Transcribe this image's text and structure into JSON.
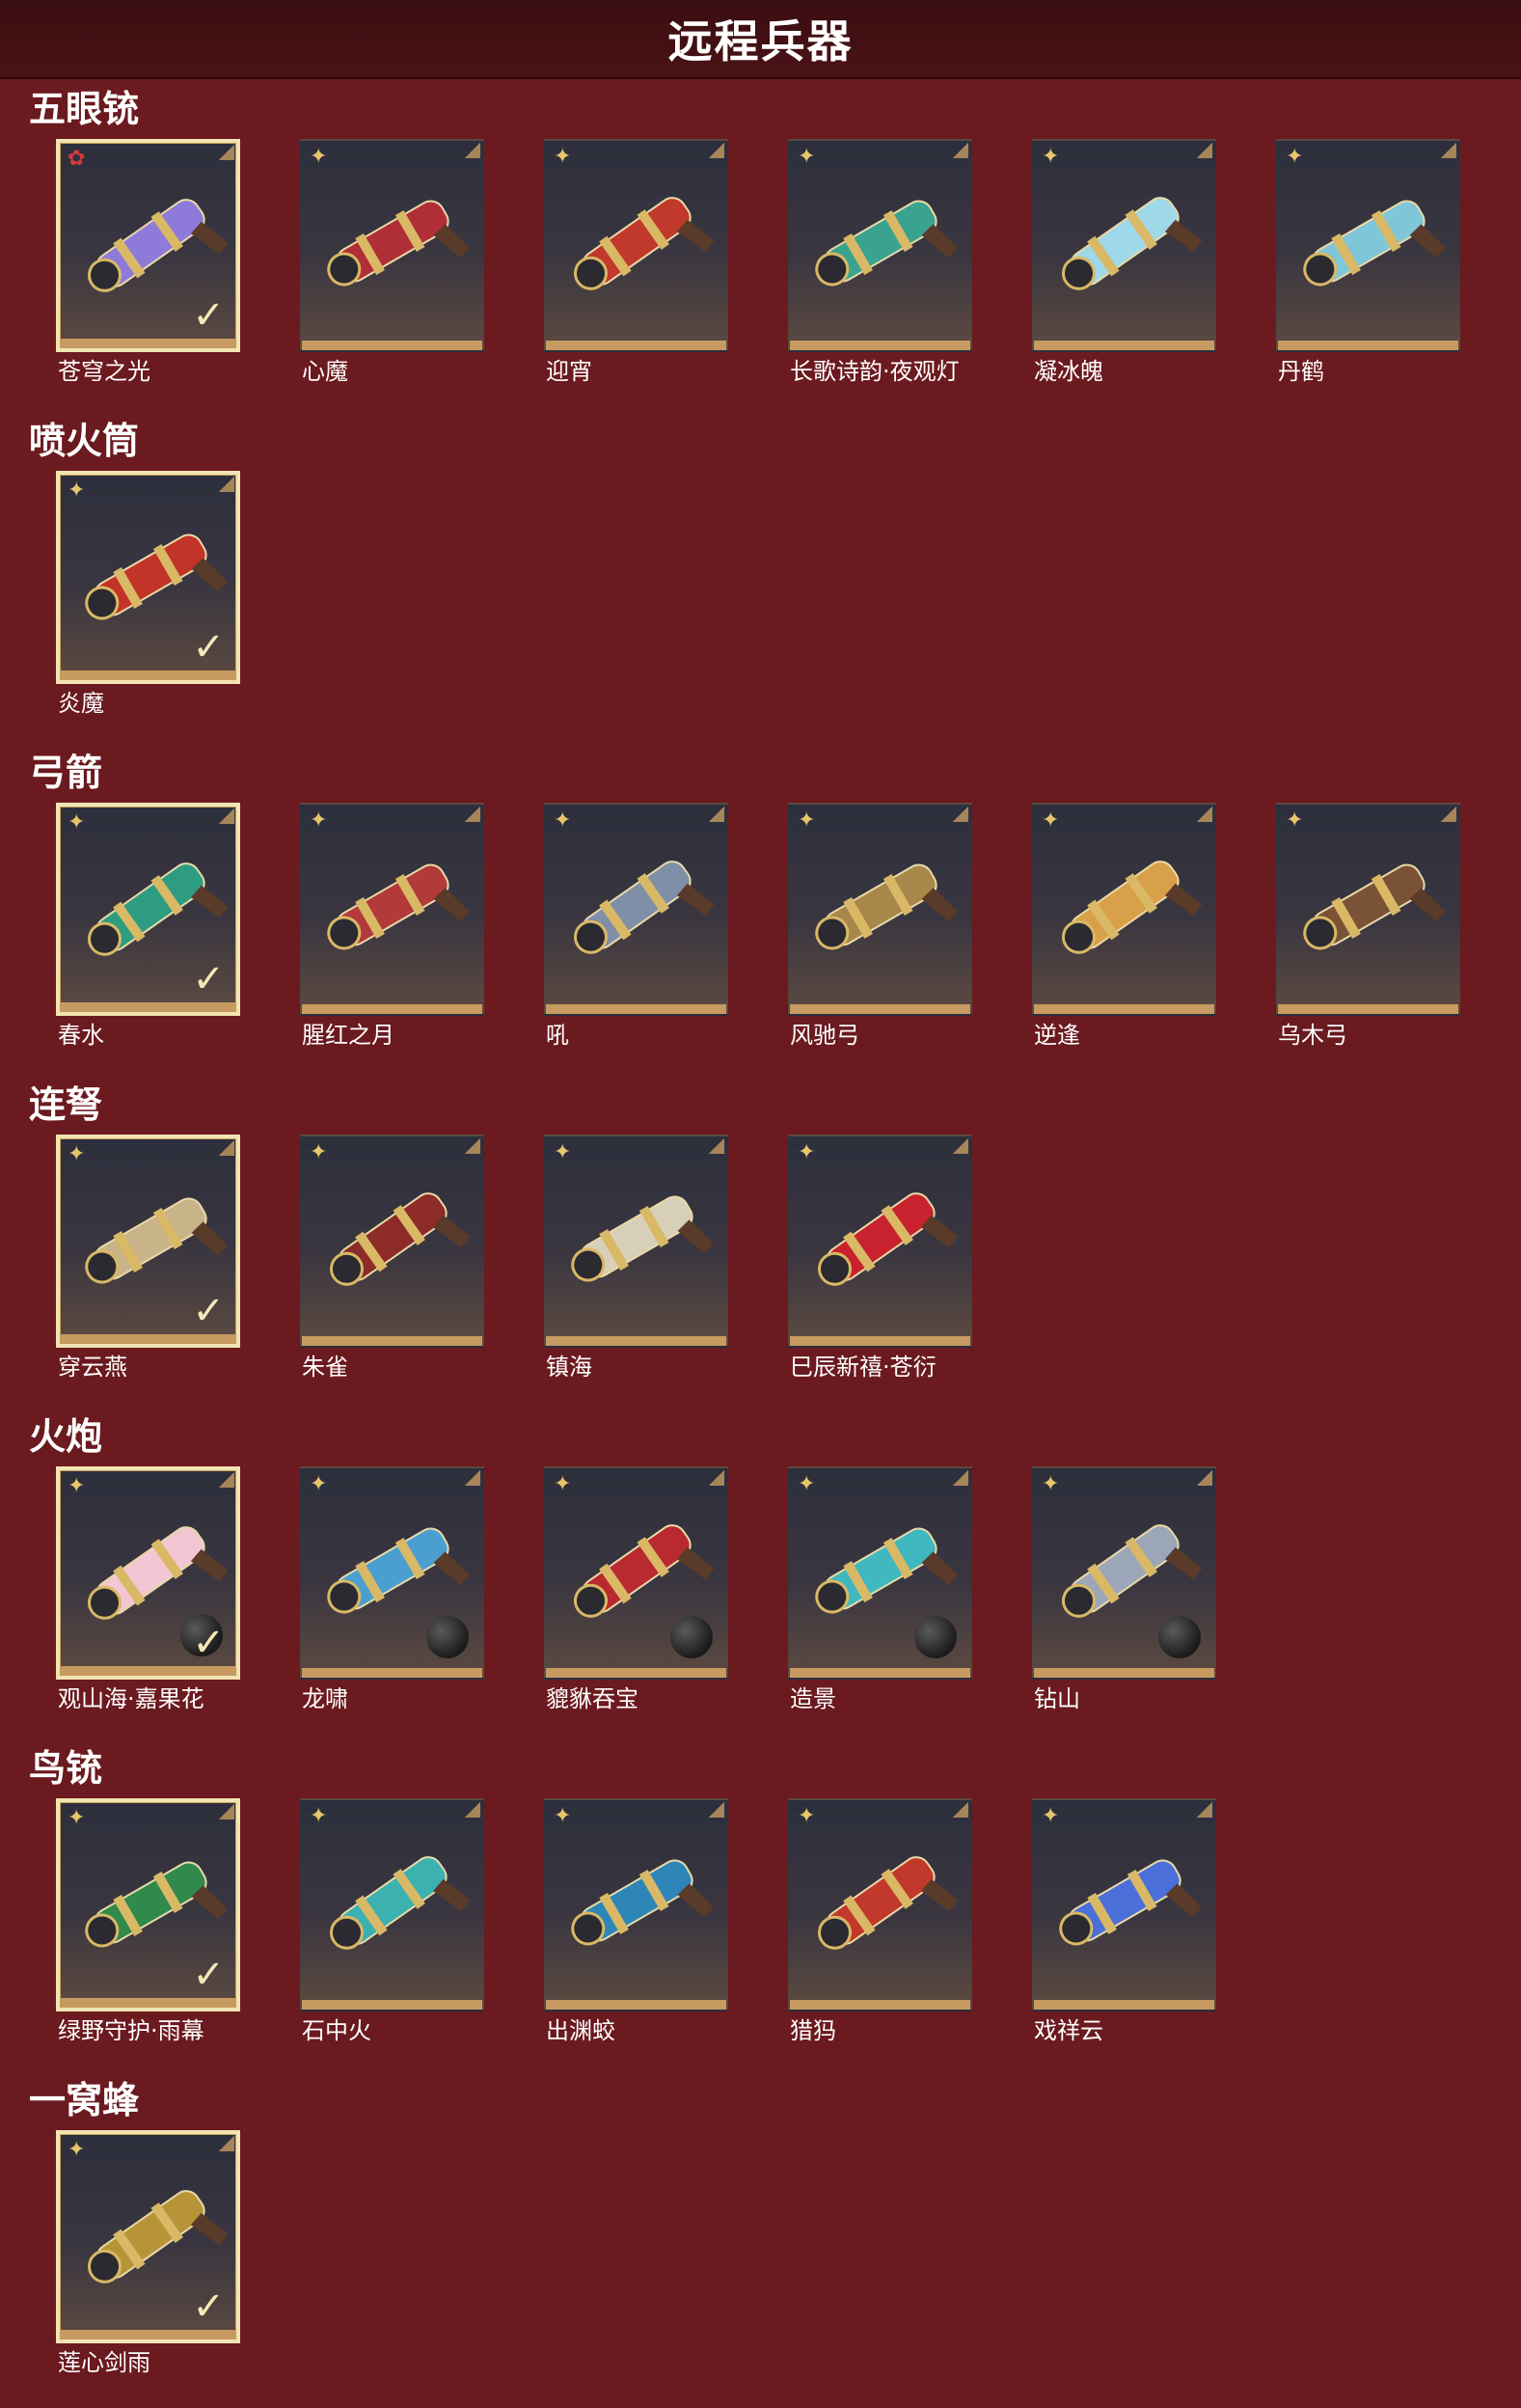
{
  "page": {
    "title": "远程兵器"
  },
  "colors": {
    "background": "#6b1a1f",
    "header": "#3a0e11",
    "tile_border_selected": "#f2e3b3",
    "tile_base": "#c79a61",
    "rarity_gold": "#e6c56c",
    "rarity_red": "#d43a3a"
  },
  "icons": {
    "rarity": "flower-emblem-icon",
    "owned": "check-icon",
    "corner": "corner-fold-icon",
    "ammo": "cannonball-icon"
  },
  "sections": [
    {
      "title": "五眼铳",
      "items": [
        {
          "name": "苍穹之光",
          "selected": true,
          "rarity": "red",
          "art_color": "#8e7ad8"
        },
        {
          "name": "心魔",
          "selected": false,
          "rarity": "gold",
          "art_color": "#b02f36"
        },
        {
          "name": "迎宵",
          "selected": false,
          "rarity": "gold",
          "art_color": "#c0392b"
        },
        {
          "name": "长歌诗韵·夜观灯",
          "selected": false,
          "rarity": "gold",
          "art_color": "#3aa38f"
        },
        {
          "name": "凝冰魄",
          "selected": false,
          "rarity": "gold",
          "art_color": "#9fd8e8"
        },
        {
          "name": "丹鹤",
          "selected": false,
          "rarity": "gold",
          "art_color": "#7ec6d8"
        }
      ]
    },
    {
      "title": "喷火筒",
      "items": [
        {
          "name": "炎魔",
          "selected": true,
          "rarity": "gold",
          "art_color": "#c23328"
        }
      ]
    },
    {
      "title": "弓箭",
      "items": [
        {
          "name": "春水",
          "selected": true,
          "rarity": "gold",
          "art_color": "#2e9c80"
        },
        {
          "name": "腥红之月",
          "selected": false,
          "rarity": "gold",
          "art_color": "#b23a3a"
        },
        {
          "name": "吼",
          "selected": false,
          "rarity": "gold",
          "art_color": "#7f8fa8"
        },
        {
          "name": "风驰弓",
          "selected": false,
          "rarity": "gold",
          "art_color": "#a8874a"
        },
        {
          "name": "逆逢",
          "selected": false,
          "rarity": "gold",
          "art_color": "#d9a04a"
        },
        {
          "name": "乌木弓",
          "selected": false,
          "rarity": "gold",
          "art_color": "#7a5236"
        }
      ]
    },
    {
      "title": "连弩",
      "items": [
        {
          "name": "穿云燕",
          "selected": true,
          "rarity": "gold",
          "art_color": "#c9b48a"
        },
        {
          "name": "朱雀",
          "selected": false,
          "rarity": "gold",
          "art_color": "#8c2b28"
        },
        {
          "name": "镇海",
          "selected": false,
          "rarity": "gold",
          "art_color": "#d8cfb8"
        },
        {
          "name": "巳辰新禧·苍衍",
          "selected": false,
          "rarity": "gold",
          "art_color": "#c8222e"
        }
      ]
    },
    {
      "title": "火炮",
      "items": [
        {
          "name": "观山海·嘉果花",
          "selected": true,
          "rarity": "gold",
          "art_color": "#f2c6d2",
          "ammo": true
        },
        {
          "name": "龙啸",
          "selected": false,
          "rarity": "gold",
          "art_color": "#4a9fd0",
          "ammo": true
        },
        {
          "name": "貔貅吞宝",
          "selected": false,
          "rarity": "gold",
          "art_color": "#b82a30",
          "ammo": true
        },
        {
          "name": "造景",
          "selected": false,
          "rarity": "gold",
          "art_color": "#3fb8bf",
          "ammo": true
        },
        {
          "name": "钻山",
          "selected": false,
          "rarity": "gold",
          "art_color": "#9ba6b8",
          "ammo": true
        }
      ]
    },
    {
      "title": "鸟铳",
      "items": [
        {
          "name": "绿野守护·雨幕",
          "selected": true,
          "rarity": "gold",
          "art_color": "#2f8a4c"
        },
        {
          "name": "石中火",
          "selected": false,
          "rarity": "gold",
          "art_color": "#3bb1b0"
        },
        {
          "name": "出渊蛟",
          "selected": false,
          "rarity": "gold",
          "art_color": "#2e86b8"
        },
        {
          "name": "猎犸",
          "selected": false,
          "rarity": "gold",
          "art_color": "#c0392b"
        },
        {
          "name": "戏祥云",
          "selected": false,
          "rarity": "gold",
          "art_color": "#4a6fd8"
        }
      ]
    },
    {
      "title": "一窝蜂",
      "items": [
        {
          "name": "莲心剑雨",
          "selected": true,
          "rarity": "gold",
          "art_color": "#b89438"
        }
      ]
    }
  ]
}
